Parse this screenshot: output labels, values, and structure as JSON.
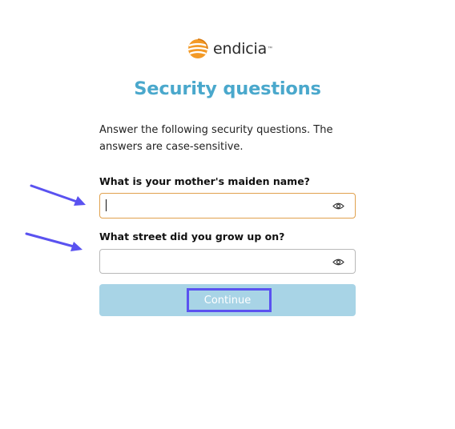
{
  "brand": {
    "name": "endicia",
    "trademark": "™",
    "logo_colors": {
      "orange": "#f39a27",
      "dark_orange": "#d87a10"
    }
  },
  "page": {
    "title": "Security questions",
    "instructions": "Answer the following security questions. The answers are case-sensitive."
  },
  "questions": [
    {
      "label": "What is your mother's maiden name?",
      "value": "",
      "focused": true
    },
    {
      "label": "What street did you grow up on?",
      "value": "",
      "focused": false
    }
  ],
  "actions": {
    "continue_label": "Continue"
  },
  "annotation_color": "#5a52f0",
  "icons": [
    "eye-icon",
    "endicia-logo-icon",
    "arrow-icon"
  ]
}
